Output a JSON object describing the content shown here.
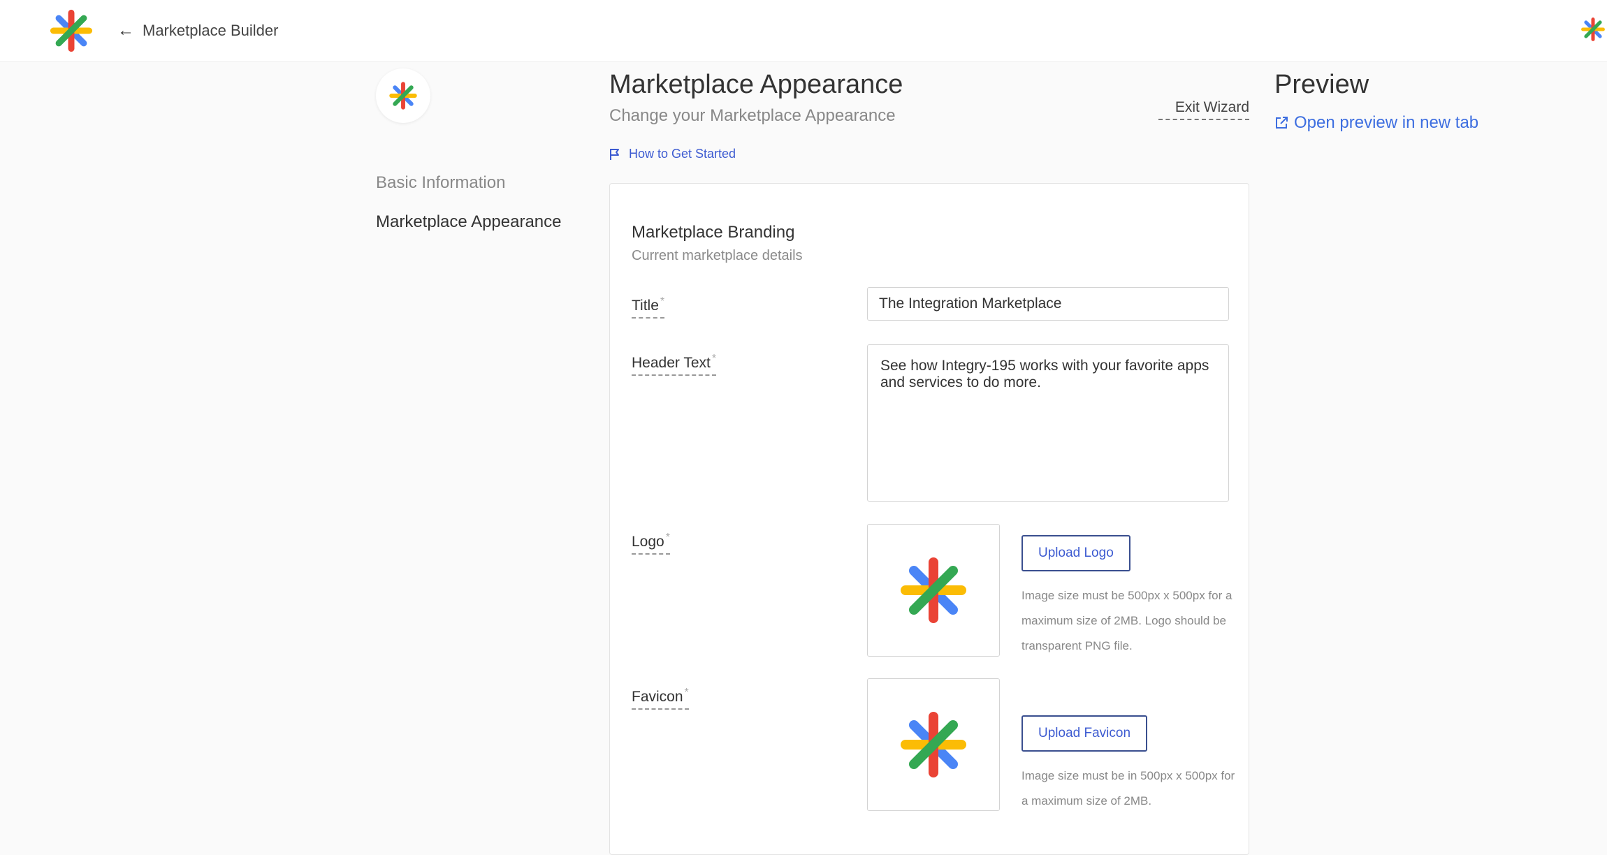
{
  "topbar": {
    "back_label": "Marketplace Builder",
    "brand_icon": "asterisk-logo-icon",
    "user_icon": "asterisk-logo-icon"
  },
  "sidebar": {
    "items": [
      {
        "label": "Basic Information",
        "active": false
      },
      {
        "label": "Marketplace Appearance",
        "active": true
      }
    ]
  },
  "header": {
    "title": "Marketplace Appearance",
    "subtitle": "Change your Marketplace Appearance",
    "exit_label": "Exit Wizard",
    "howto_label": "How to Get Started"
  },
  "branding": {
    "title": "Marketplace Branding",
    "subtitle": "Current marketplace details",
    "title_field": {
      "label": "Title",
      "value": "The Integration Marketplace"
    },
    "header_field": {
      "label": "Header Text",
      "value": "See how Integry-195 works with your favorite apps and services to do more."
    },
    "logo_field": {
      "label": "Logo",
      "button": "Upload Logo",
      "hint": "Image size must be 500px x 500px for a maximum size of 2MB. Logo should be transparent PNG file."
    },
    "favicon_field": {
      "label": "Favicon",
      "button": "Upload Favicon",
      "hint": "Image size must be in 500px x 500px for a maximum size of 2MB."
    },
    "required_mark": "*"
  },
  "preview": {
    "title": "Preview",
    "link_label": "Open preview in new tab"
  },
  "colors": {
    "accent": "#3d5bd1",
    "link": "#3d6ee0",
    "logo_blue": "#4a85f6",
    "logo_red": "#ea4335",
    "logo_yellow": "#fbbc05",
    "logo_green": "#34a853"
  }
}
